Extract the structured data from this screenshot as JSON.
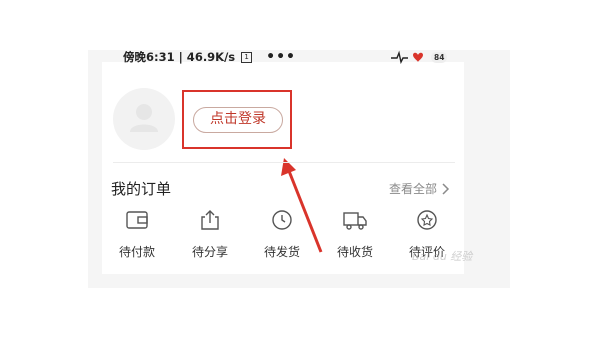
{
  "status_bar": {
    "time_speed": "傍晚6:31 | 46.9K/s",
    "sim_glyph": "1",
    "more": "•••",
    "battery": "84"
  },
  "profile": {
    "login_label": "点击登录"
  },
  "orders": {
    "title": "我的订单",
    "view_all": "查看全部",
    "items": [
      {
        "label": "待付款",
        "icon": "wallet-icon"
      },
      {
        "label": "待分享",
        "icon": "share-icon"
      },
      {
        "label": "待发货",
        "icon": "clock-icon"
      },
      {
        "label": "待收货",
        "icon": "truck-icon"
      },
      {
        "label": "待评价",
        "icon": "review-icon"
      }
    ]
  },
  "watermark": "Bai du 经验",
  "colors": {
    "accent_red": "#d9342b",
    "button_text": "#c0392b",
    "muted_text": "#8a8a8a"
  }
}
